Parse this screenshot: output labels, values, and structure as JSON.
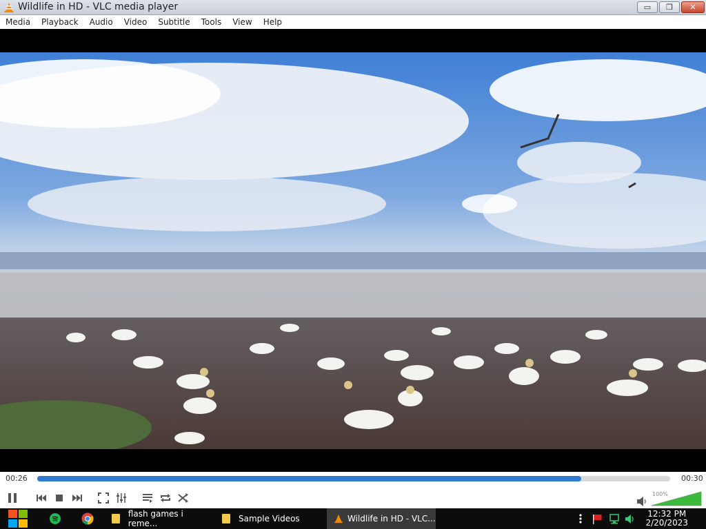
{
  "window": {
    "title": "Wildlife in HD - VLC media player"
  },
  "menu": [
    "Media",
    "Playback",
    "Audio",
    "Video",
    "Subtitle",
    "Tools",
    "View",
    "Help"
  ],
  "player": {
    "elapsed": "00:26",
    "duration": "00:30",
    "progress_fraction": 0.86,
    "volume_label": "100%",
    "volume_fraction": 1.0,
    "accent_color": "#2f7bcf"
  },
  "taskbar": {
    "items": [
      {
        "label": "flash games i reme..."
      },
      {
        "label": "Sample Videos"
      },
      {
        "label": "Wildlife in HD - VLC..."
      }
    ],
    "time": "12:32 PM",
    "date": "2/20/2023"
  }
}
